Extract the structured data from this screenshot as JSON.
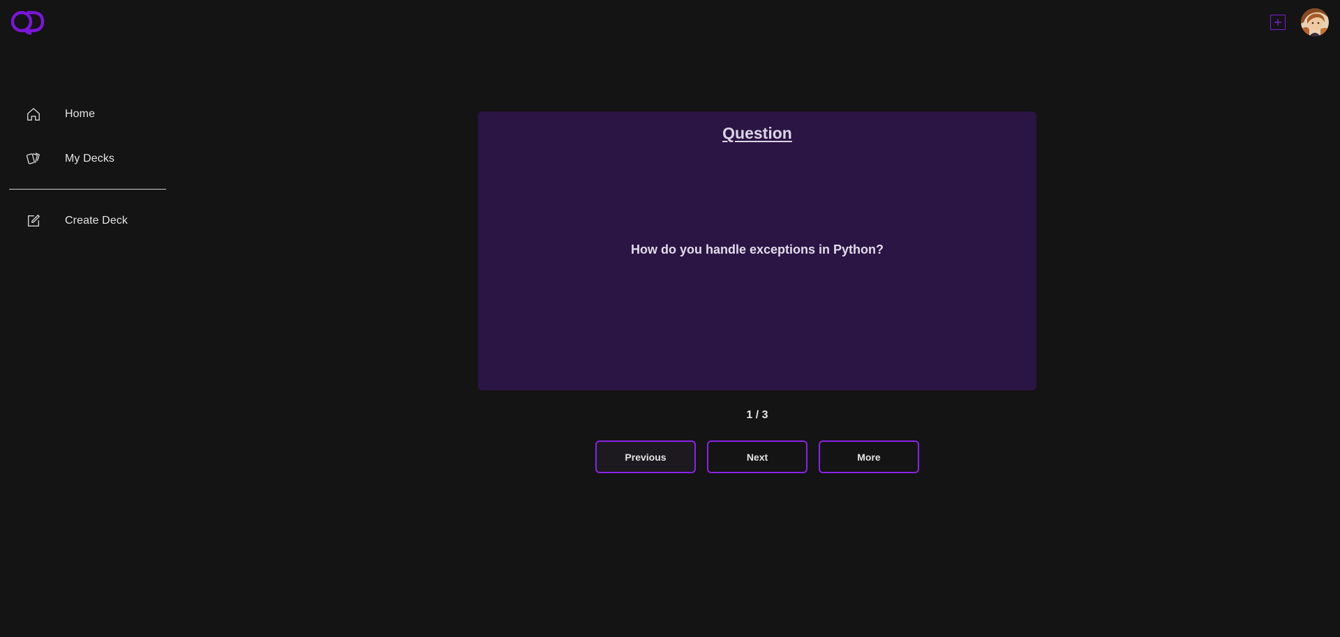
{
  "header": {
    "logo_icon": "qd-logo-icon",
    "add_icon": "plus-square-icon",
    "avatar_icon": "user-avatar-icon",
    "accent_color": "#8a22e8"
  },
  "sidebar": {
    "items": [
      {
        "label": "Home",
        "icon": "home-icon"
      },
      {
        "label": "My Decks",
        "icon": "cards-icon"
      },
      {
        "label": "Create Deck",
        "icon": "edit-icon"
      }
    ]
  },
  "card": {
    "heading": "Question",
    "text": "How do you handle exceptions in Python?",
    "background_color": "#2b1544"
  },
  "pagination": {
    "counter": "1 / 3"
  },
  "controls": {
    "previous_label": "Previous",
    "next_label": "Next",
    "more_label": "More"
  }
}
